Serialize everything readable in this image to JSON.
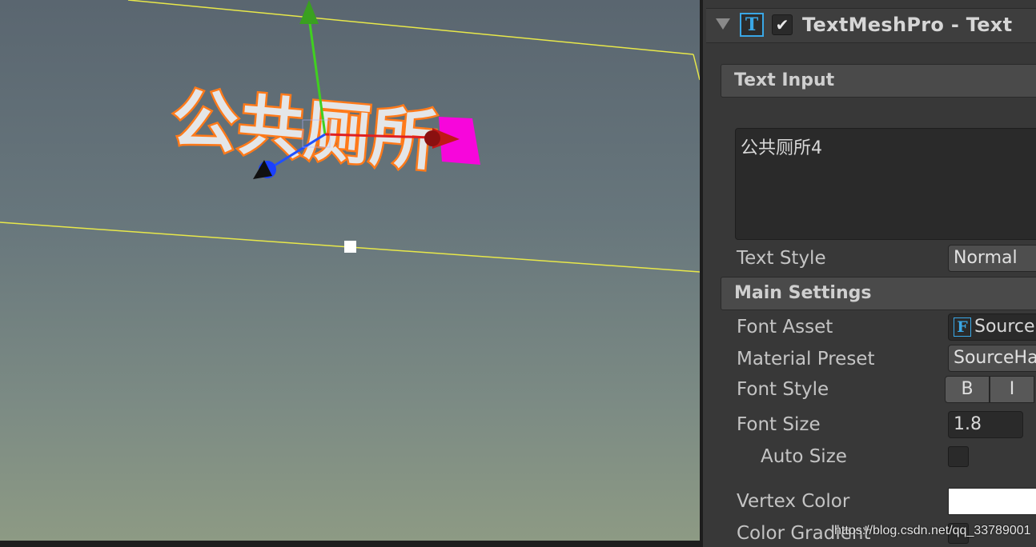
{
  "scene": {
    "label_text": "公共厕所"
  },
  "component": {
    "icon_glyph": "T",
    "enabled_mark": "✔",
    "title": "TextMeshPro - Text"
  },
  "text_input": {
    "section": "Text Input",
    "value": "公共厕所4"
  },
  "text_style": {
    "label": "Text Style",
    "value": "Normal"
  },
  "main_settings": {
    "section": "Main Settings",
    "font_asset_label": "Font Asset",
    "font_asset_icon": "F",
    "font_asset_value": "SourceHanSans",
    "material_preset_label": "Material Preset",
    "material_preset_value": "SourceHanSans",
    "font_style_label": "Font Style",
    "font_style_bold": "B",
    "font_style_italic": "I",
    "font_size_label": "Font Size",
    "font_size_value": "1.8",
    "auto_size_label": "Auto Size",
    "vertex_color_label": "Vertex Color",
    "vertex_color": "#ffffff",
    "color_gradient_label": "Color Gradient"
  },
  "watermark": "https://blog.csdn.net/qq_33789001",
  "colors": {
    "accent": "#3aa7e6",
    "gizmo_x": "#e02020",
    "gizmo_y": "#40d020",
    "gizmo_z": "#2040ff",
    "outline": "#ff7a1a",
    "selection_box": "#e8e84a",
    "pivot_handle": "#ff00e0"
  }
}
